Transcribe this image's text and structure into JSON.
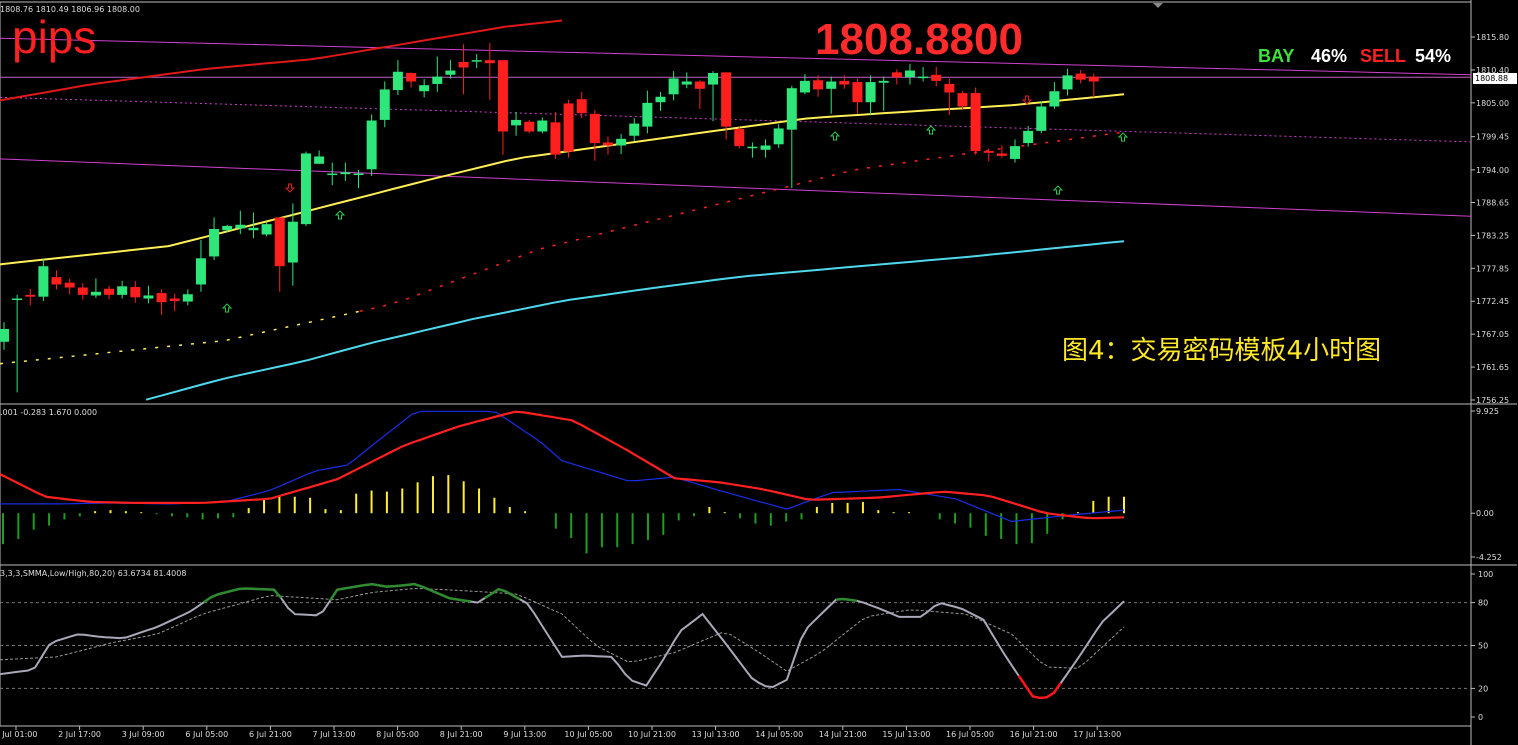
{
  "ohlc_text": "1808.76 1810.49 1806.96 1808.00",
  "logo": "pips",
  "big_price": "1808.8800",
  "ratio": {
    "buy_label": "BAY",
    "buy_pct": "46%",
    "sell_label": "SELL",
    "sell_pct": "54%"
  },
  "caption": "图4：交易密码模板4小时图",
  "current_price_tag": "1808.88",
  "macd_label": ".001 -0.283 1.670 0.000",
  "stoch_label": "3,3,3,SMMA,Low/High,80,20) 63.6734 81.4008",
  "colors": {
    "bull": "#2ee67a",
    "bear": "#ff1f1f",
    "ma_yellow": "#ffee55",
    "ma_cyan": "#4fd8ec",
    "channel": "#d040d0",
    "macd_main": "#1a2ee8",
    "macd_signal": "#ff2020",
    "stoch_main": "#a8a8b8"
  },
  "chart_data": [
    {
      "type": "candlestick",
      "price_axis_ticks": [
        "1815.80",
        "1810.40",
        "1805.00",
        "1799.45",
        "1794.00",
        "1788.65",
        "1783.25",
        "1777.85",
        "1772.45",
        "1767.05",
        "1761.65",
        "1756.25"
      ],
      "ylim": [
        1756.25,
        1815.8
      ],
      "time_ticks": [
        "1 Jul 01:00",
        "2 Jul 17:00",
        "3 Jul 09:00",
        "6 Jul 05:00",
        "6 Jul 21:00",
        "7 Jul 13:00",
        "8 Jul 05:00",
        "8 Jul 21:00",
        "9 Jul 13:00",
        "10 Jul 05:00",
        "10 Jul 21:00",
        "13 Jul 13:00",
        "14 Jul 05:00",
        "14 Jul 21:00",
        "15 Jul 13:00",
        "16 Jul 05:00",
        "16 Jul 21:00",
        "17 Jul 13:00"
      ],
      "candles": [
        [
          1765.8,
          1767.9,
          1764.5,
          1769.0
        ],
        [
          1772.9,
          1772.9,
          1757.5,
          1773.5
        ],
        [
          1773.5,
          1773.2,
          1771.8,
          1774.5
        ],
        [
          1773.2,
          1778.2,
          1772.5,
          1779.5
        ],
        [
          1776.4,
          1775.2,
          1774.4,
          1777.5
        ],
        [
          1775.5,
          1774.7,
          1773.6,
          1776.1
        ],
        [
          1774.7,
          1773.5,
          1772.7,
          1775.4
        ],
        [
          1773.4,
          1774.0,
          1773.0,
          1776.2
        ],
        [
          1774.5,
          1773.5,
          1772.8,
          1775.0
        ],
        [
          1773.5,
          1774.9,
          1772.9,
          1775.8
        ],
        [
          1774.8,
          1773.1,
          1772.2,
          1775.8
        ],
        [
          1772.9,
          1773.4,
          1772.1,
          1775.0
        ],
        [
          1773.8,
          1772.3,
          1770.2,
          1774.4
        ],
        [
          1772.9,
          1772.5,
          1770.8,
          1773.7
        ],
        [
          1772.4,
          1773.6,
          1771.8,
          1774.4
        ],
        [
          1775.2,
          1779.5,
          1774.0,
          1782.5
        ],
        [
          1779.8,
          1784.3,
          1779.2,
          1786.2
        ],
        [
          1784.1,
          1784.8,
          1783.8,
          1785.0
        ],
        [
          1784.4,
          1785.0,
          1783.5,
          1787.3
        ],
        [
          1784.1,
          1784.5,
          1782.8,
          1787.0
        ],
        [
          1783.4,
          1785.1,
          1783.1,
          1785.5
        ],
        [
          1786.2,
          1778.2,
          1774.0,
          1786.0
        ],
        [
          1778.8,
          1785.5,
          1775.0,
          1788.5
        ],
        [
          1785.1,
          1796.7,
          1784.8,
          1797.0
        ],
        [
          1795.0,
          1796.2,
          1795.0,
          1797.2
        ],
        [
          1793.3,
          1793.4,
          1791.5,
          1795.2
        ],
        [
          1793.3,
          1793.6,
          1792.2,
          1795.2
        ],
        [
          1793.4,
          1793.4,
          1791.0,
          1794.0
        ],
        [
          1794.1,
          1802.1,
          1793.0,
          1803.1
        ],
        [
          1802.2,
          1807.2,
          1801.0,
          1808.5
        ],
        [
          1807.1,
          1810.1,
          1806.3,
          1812.0
        ],
        [
          1809.9,
          1808.5,
          1807.5,
          1810.0
        ],
        [
          1806.9,
          1807.9,
          1805.9,
          1808.9
        ],
        [
          1808.1,
          1809.3,
          1806.8,
          1812.6
        ],
        [
          1809.6,
          1810.3,
          1809.0,
          1812.0
        ],
        [
          1811.7,
          1810.8,
          1806.4,
          1814.6
        ],
        [
          1812.0,
          1812.0,
          1810.7,
          1813.0
        ],
        [
          1812.0,
          1811.5,
          1805.5,
          1814.8
        ],
        [
          1812.0,
          1800.3,
          1796.5,
          1811.5
        ],
        [
          1801.3,
          1802.2,
          1799.6,
          1803.5
        ],
        [
          1801.9,
          1800.3,
          1800.0,
          1802.2
        ],
        [
          1800.3,
          1802.1,
          1800.0,
          1802.6
        ],
        [
          1801.8,
          1796.5,
          1795.8,
          1803.5
        ],
        [
          1804.9,
          1797.0,
          1796.0,
          1805.5
        ],
        [
          1805.6,
          1803.3,
          1802.5,
          1806.8
        ],
        [
          1803.2,
          1798.4,
          1795.5,
          1803.8
        ],
        [
          1798.5,
          1798.0,
          1796.5,
          1799.5
        ],
        [
          1798.0,
          1799.1,
          1796.6,
          1799.9
        ],
        [
          1799.6,
          1801.6,
          1798.7,
          1802.5
        ],
        [
          1801.1,
          1805.0,
          1800.0,
          1807.0
        ],
        [
          1805.1,
          1806.0,
          1803.7,
          1806.8
        ],
        [
          1806.4,
          1809.0,
          1805.4,
          1810.2
        ],
        [
          1808.0,
          1808.5,
          1807.4,
          1810.0
        ],
        [
          1808.5,
          1807.3,
          1804.0,
          1808.7
        ],
        [
          1808.0,
          1809.9,
          1802.0,
          1810.2
        ],
        [
          1810.0,
          1801.1,
          1799.0,
          1809.5
        ],
        [
          1800.7,
          1797.9,
          1797.5,
          1801.0
        ],
        [
          1797.8,
          1797.8,
          1796.0,
          1798.5
        ],
        [
          1797.3,
          1798.0,
          1796.0,
          1799.0
        ],
        [
          1798.2,
          1800.8,
          1797.6,
          1801.5
        ],
        [
          1800.6,
          1807.4,
          1791.0,
          1807.8
        ],
        [
          1806.7,
          1808.6,
          1806.4,
          1809.7
        ],
        [
          1808.7,
          1807.2,
          1806.0,
          1809.5
        ],
        [
          1807.3,
          1808.5,
          1803.2,
          1809.3
        ],
        [
          1808.6,
          1808.0,
          1807.3,
          1809.5
        ],
        [
          1808.4,
          1805.1,
          1803.2,
          1809.0
        ],
        [
          1805.1,
          1808.4,
          1803.0,
          1809.5
        ],
        [
          1808.3,
          1808.6,
          1803.7,
          1809.3
        ],
        [
          1810.0,
          1809.2,
          1808.0,
          1810.5
        ],
        [
          1809.2,
          1810.3,
          1808.0,
          1811.4
        ],
        [
          1809.1,
          1809.3,
          1808.5,
          1810.9
        ],
        [
          1809.6,
          1808.6,
          1807.7,
          1810.9
        ],
        [
          1808.1,
          1806.7,
          1803.0,
          1809.0
        ],
        [
          1806.6,
          1804.4,
          1803.8,
          1806.9
        ],
        [
          1806.6,
          1797.1,
          1796.5,
          1807.5
        ],
        [
          1797.1,
          1796.8,
          1795.4,
          1797.5
        ],
        [
          1796.7,
          1796.3,
          1796.0,
          1798.0
        ],
        [
          1795.8,
          1797.9,
          1795.2,
          1799.0
        ],
        [
          1798.4,
          1800.4,
          1797.8,
          1801.2
        ],
        [
          1800.4,
          1804.4,
          1800.0,
          1805.2
        ],
        [
          1804.4,
          1806.9,
          1804.0,
          1808.4
        ],
        [
          1807.2,
          1809.5,
          1806.2,
          1810.6
        ],
        [
          1809.8,
          1808.8,
          1808.2,
          1810.4
        ],
        [
          1809.3,
          1808.5,
          1805.9,
          1809.8
        ]
      ]
    },
    {
      "type": "histogram",
      "axis_ticks": [
        "9.925",
        "0.00",
        "-4.252"
      ],
      "ylim": [
        -4.252,
        9.925
      ]
    },
    {
      "type": "line",
      "axis_ticks": [
        "100",
        "80",
        "50",
        "20",
        "0"
      ],
      "ylim": [
        0,
        100
      ],
      "levels": [
        80,
        50,
        20
      ]
    }
  ]
}
